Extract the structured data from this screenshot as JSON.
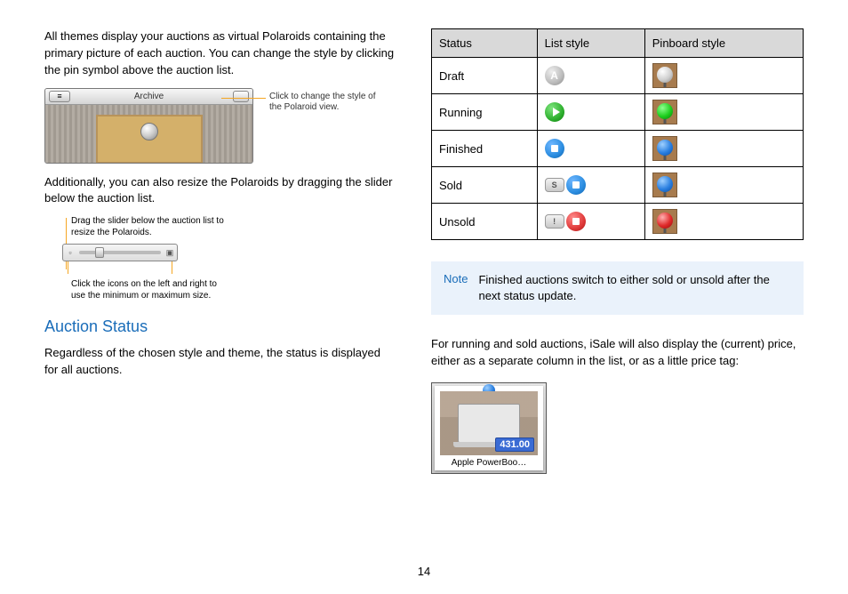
{
  "page_number": "14",
  "left": {
    "intro": "All themes display your auctions as virtual Polaroids containing the primary picture of each auction. You can change the style by clicking the pin symbol above the auction list.",
    "fig1_toolbar_label": "Archive",
    "fig1_back_glyph": "≡",
    "callout1": "Click to change the style of the Polaroid view.",
    "resize_text": "Additionally, you can also resize the Polaroids by dragging the slider below the auction list.",
    "callout2_top": "Drag the slider below the auction list to resize the Polaroids.",
    "callout2_bottom": "Click the icons on the left and right to use the minimum or maximum size.",
    "section_heading": "Auction Status",
    "status_intro": "Regardless of the chosen style and theme, the status is displayed for all auctions."
  },
  "right": {
    "table_headers": {
      "status": "Status",
      "list": "List style",
      "pin": "Pinboard style"
    },
    "rows": {
      "draft": "Draft",
      "running": "Running",
      "finished": "Finished",
      "sold": "Sold",
      "unsold": "Unsold"
    },
    "glyph_a": "A",
    "badge_sold": "S",
    "badge_unsold": "!",
    "note_label": "Note",
    "note_text": "Finished auctions switch to either sold or unsold after the next status update.",
    "price_text": "For running and sold auctions, iSale will also display the (current) price, either as a separate column in the list, or as a little price tag:",
    "polaroid_price": "431.00",
    "polaroid_caption": "Apple PowerBoo…"
  }
}
